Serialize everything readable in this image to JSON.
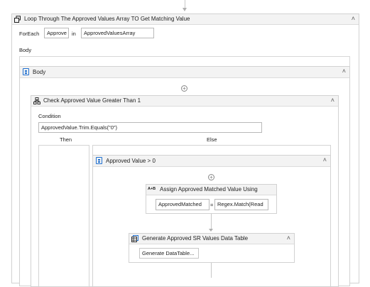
{
  "foreach": {
    "title": "Loop Through The Approved Values Array TO Get Matching Value",
    "foreach_label": "ForEach",
    "item_var": "Approve",
    "in_label": "in",
    "collection": "ApprovedValuesArray",
    "body_label": "Body"
  },
  "body_sequence": {
    "title": "Body"
  },
  "if_activity": {
    "title": "Check Approved Value Greater Than 1",
    "condition_label": "Condition",
    "condition": "ApprovedValue.Trim.Equals(\"0\")",
    "then_label": "Then",
    "else_label": "Else"
  },
  "else_sequence": {
    "title": "Approved Value > 0"
  },
  "assign": {
    "icon_text": "A+B",
    "title": "Assign Approved Matched Value Using",
    "to": "ApprovedMatched",
    "equals": "=",
    "value": "Regex.Match(Read"
  },
  "datatable": {
    "title": "Generate Approved SR Values Data Table",
    "button": "Generate DataTable..."
  },
  "icons": {
    "collapse": "double-chevron-up-icon",
    "add": "plus-circle-icon",
    "foreach": "foreach-icon",
    "sequence": "sequence-icon",
    "if": "if-icon",
    "assign": "assign-icon",
    "datatable": "datatable-icon"
  }
}
